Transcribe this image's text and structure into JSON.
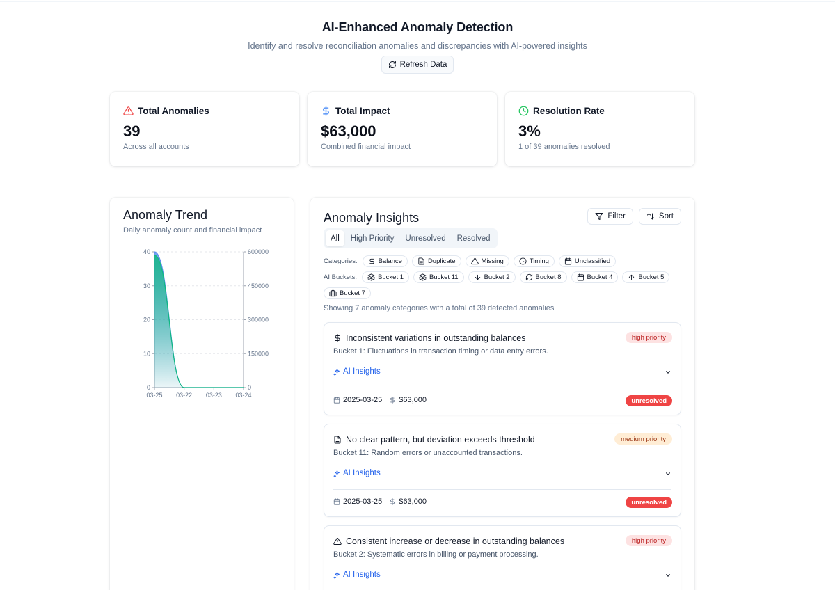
{
  "header": {
    "title": "AI-Enhanced Anomaly Detection",
    "subtitle": "Identify and resolve reconciliation anomalies and discrepancies with AI-powered insights",
    "refresh_label": "Refresh Data"
  },
  "stats": [
    {
      "title": "Total Anomalies",
      "value": "39",
      "desc": "Across all accounts",
      "icon": "alert-triangle-icon",
      "color": "#ef4444"
    },
    {
      "title": "Total Impact",
      "value": "$63,000",
      "desc": "Combined financial impact",
      "icon": "dollar-icon",
      "color": "#3b82f6"
    },
    {
      "title": "Resolution Rate",
      "value": "3%",
      "desc": "1 of 39 anomalies resolved",
      "icon": "clock-icon",
      "color": "#22c55e"
    }
  ],
  "trend": {
    "title": "Anomaly Trend",
    "subtitle": "Daily anomaly count and financial impact"
  },
  "chart_data": {
    "type": "area",
    "x": [
      "03-25",
      "03-22",
      "03-23",
      "03-24"
    ],
    "series": [
      {
        "values": [
          40,
          0,
          0,
          0
        ],
        "axis": "right",
        "color": "#5b8def"
      },
      {
        "values": [
          39,
          0,
          0,
          0
        ],
        "axis": "left",
        "color": "#10b981"
      }
    ],
    "left_axis": {
      "ylim": [
        0,
        40
      ],
      "ticks": [
        0,
        10,
        20,
        30,
        40
      ]
    },
    "right_axis": {
      "ylim": [
        0,
        600000
      ],
      "ticks": [
        0,
        150000,
        300000,
        450000,
        600000
      ]
    },
    "grid": true
  },
  "insights": {
    "title": "Anomaly Insights",
    "filter_label": "Filter",
    "sort_label": "Sort",
    "tabs": [
      "All",
      "High Priority",
      "Unresolved",
      "Resolved"
    ],
    "categories_label": "Categories:",
    "categories": [
      {
        "label": "Balance",
        "icon": "dollar-icon"
      },
      {
        "label": "Duplicate",
        "icon": "file-icon"
      },
      {
        "label": "Missing",
        "icon": "alert-triangle-icon"
      },
      {
        "label": "Timing",
        "icon": "clock-icon"
      },
      {
        "label": "Unclassified",
        "icon": "calendar-icon"
      }
    ],
    "buckets_label": "AI Buckets:",
    "buckets": [
      {
        "label": "Bucket 1",
        "icon": "layers-icon"
      },
      {
        "label": "Bucket 11",
        "icon": "layers-icon"
      },
      {
        "label": "Bucket 2",
        "icon": "arrow-down-icon"
      },
      {
        "label": "Bucket 8",
        "icon": "refresh-icon"
      },
      {
        "label": "Bucket 4",
        "icon": "calendar-icon"
      },
      {
        "label": "Bucket 5",
        "icon": "arrow-up-icon"
      },
      {
        "label": "Bucket 7",
        "icon": "briefcase-icon"
      }
    ],
    "summary": "Showing 7 anomaly categories with a total of 39 detected anomalies",
    "cards": [
      {
        "title": "Inconsistent variations in outstanding balances",
        "desc": "Bucket 1: Fluctuations in transaction timing or data entry errors.",
        "priority": "high priority",
        "priority_level": "high",
        "icon": "dollar-icon",
        "ai_label": "AI Insights",
        "date": "2025-03-25",
        "amount": "$63,000",
        "status": "unresolved"
      },
      {
        "title": "No clear pattern, but deviation exceeds threshold",
        "desc": "Bucket 11: Random errors or unaccounted transactions.",
        "priority": "medium priority",
        "priority_level": "medium",
        "icon": "file-icon",
        "ai_label": "AI Insights",
        "date": "2025-03-25",
        "amount": "$63,000",
        "status": "unresolved"
      },
      {
        "title": "Consistent increase or decrease in outstanding balances",
        "desc": "Bucket 2: Systematic errors in billing or payment processing.",
        "priority": "high priority",
        "priority_level": "high",
        "icon": "alert-triangle-icon",
        "ai_label": "AI Insights"
      }
    ]
  }
}
